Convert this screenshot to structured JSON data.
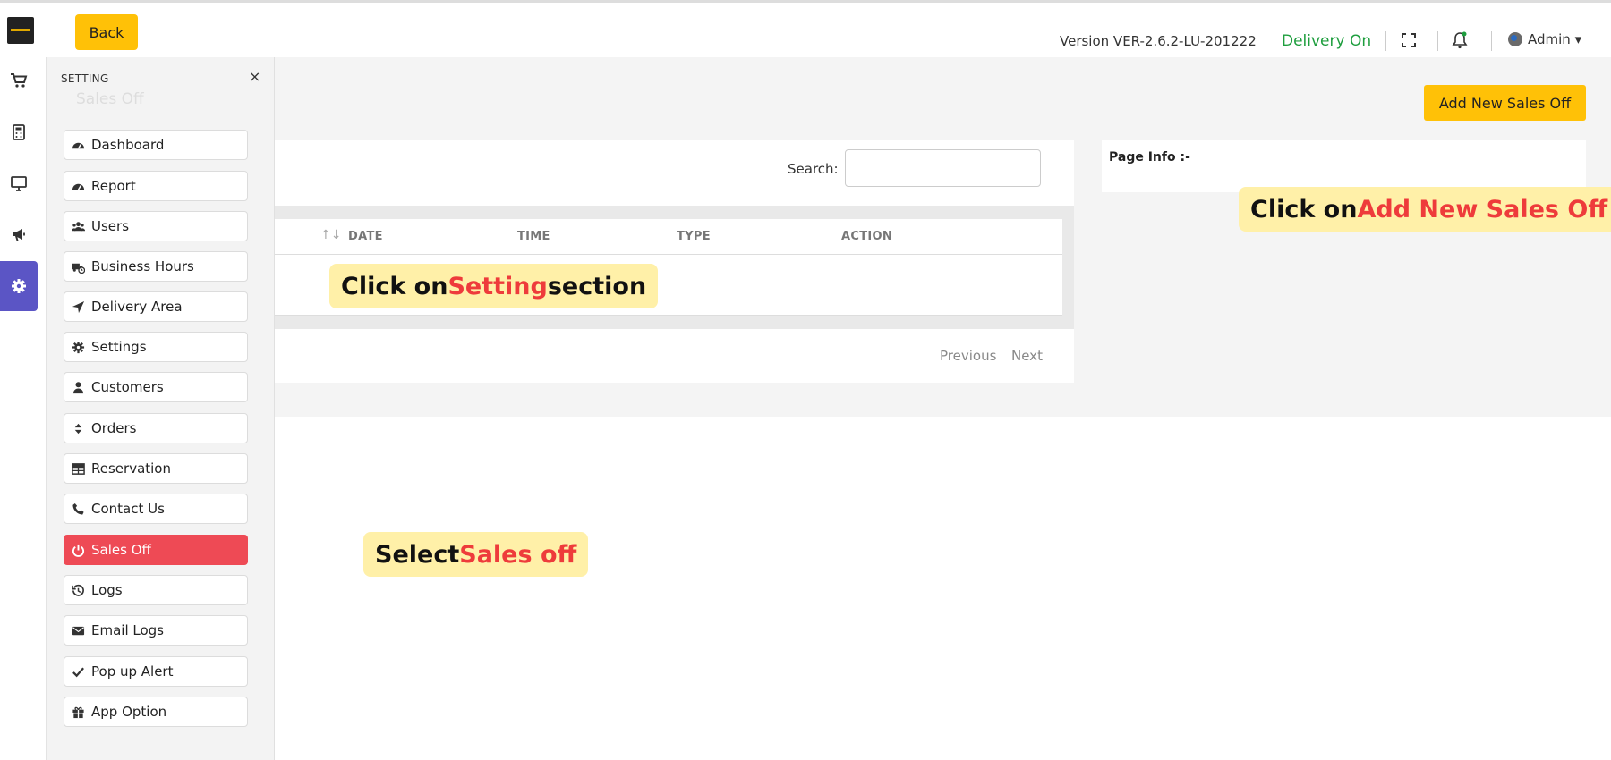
{
  "header": {
    "back_label": "Back",
    "version": "Version VER-2.6.2-LU-201222",
    "delivery": "Delivery On",
    "admin": "Admin ▾"
  },
  "rail": {
    "items": [
      {
        "icon": "cart-icon"
      },
      {
        "icon": "calculator-icon"
      },
      {
        "icon": "monitor-icon"
      },
      {
        "icon": "megaphone-icon"
      },
      {
        "icon": "gear-icon",
        "active": true
      }
    ],
    "active_color": "#5b55c5"
  },
  "page": {
    "ghost_title": "Sales Off",
    "add_button": "Add New Sales Off",
    "search_label": "Search:",
    "columns": [
      "DATE",
      "TIME",
      "TYPE",
      "ACTION"
    ],
    "sort_glyph": "↑↓",
    "pager_prev": "Previous",
    "pager_next": "Next",
    "info_title": "Page Info :-"
  },
  "panel": {
    "title": "SETTING",
    "close": "×",
    "items": [
      {
        "label": "Dashboard",
        "icon": "dashboard-icon"
      },
      {
        "label": "Report",
        "icon": "dashboard-icon"
      },
      {
        "label": "Users",
        "icon": "users-icon"
      },
      {
        "label": "Business Hours",
        "icon": "truck-clock-icon"
      },
      {
        "label": "Delivery Area",
        "icon": "location-arrow-icon"
      },
      {
        "label": "Settings",
        "icon": "gear-icon"
      },
      {
        "label": "Customers",
        "icon": "user-icon"
      },
      {
        "label": "Orders",
        "icon": "sort-icon"
      },
      {
        "label": "Reservation",
        "icon": "table-icon"
      },
      {
        "label": "Contact Us",
        "icon": "phone-icon"
      },
      {
        "label": "Sales Off",
        "icon": "power-icon",
        "active": true
      },
      {
        "label": "Logs",
        "icon": "history-icon"
      },
      {
        "label": "Email Logs",
        "icon": "envelope-icon"
      },
      {
        "label": "Pop up Alert",
        "icon": "check-icon"
      },
      {
        "label": "App Option",
        "icon": "gift-icon"
      }
    ],
    "active_color": "#ee4a55"
  },
  "tooltips": {
    "setting": {
      "pre": "Click on ",
      "hl": "Setting",
      "post": " section"
    },
    "sales": {
      "pre": "Select ",
      "hl": "Sales off"
    },
    "add": {
      "pre": "Click on ",
      "hl": "Add New Sales Off"
    }
  },
  "colors": {
    "accent_yellow": "#ffc107",
    "delivery_green": "#1e9e3e",
    "highlight_red": "#ee3b3b",
    "tooltip_bg": "#fff0a8"
  }
}
